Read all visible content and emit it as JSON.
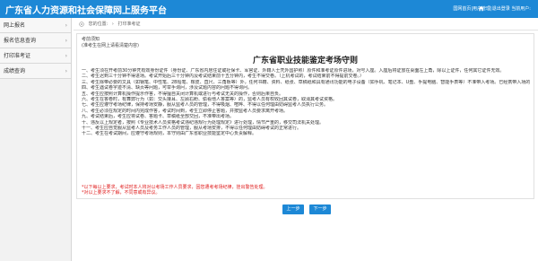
{
  "header": {
    "title": "广东省人力资源和社会保障网上服务平台",
    "user_info": "国网首页|用户管理|退出登录  当前用户:"
  },
  "sidebar": {
    "items": [
      {
        "label": "网上报名"
      },
      {
        "label": "报名信息查询"
      },
      {
        "label": "打印准考证"
      },
      {
        "label": "成绩查询"
      }
    ]
  },
  "breadcrumb": {
    "prefix": "您的位置:",
    "current": "打印准考证"
  },
  "notice": {
    "head_line1": "考前须知",
    "head_line2": "(准考生在网上请看清楚内容)",
    "title": "广东省职业技能鉴定考场守则",
    "rules": [
      "一、考生须在开考前30分钟凭有效身份证件（身份证、广东省内居住证或社保卡、军官证、外籍人士凭外国护照）原件和准考证原件进场，对号入座。入座后将证放在桌面左上角，除以上证件，任何其它证件无效。",
      "二、考生迟到三十分钟不得进场。考试开始后三十分钟内及考试结束前十五分钟内，考生不得交卷。（上机考试的，考试结束前不得提前交卷。）",
      "三、考生除带必要的文具（如钢笔、中性笔、2B铅笔、橡皮、直尺、三角板等）外，任何书籍、资料、纸张、草稿纸和具有通讯功能的电子设备（如手机、笔记本、U盘、手提电脑、智能手表等）不准带入考场。已经携带入场的应按照监考人员的要求，集中存放在指定地点，考试期间，不准取用和使用，考试期间手机应关机或设置为飞行模式。",
      "四、考生遇试卷字迹不清、缺页等问题，可举手询问，涉及试题内容的问题不得询问。",
      "五、考生应按照计算机操作提示作答，不得擅自关闭计算机或进行与考试无关的操作，否则后果自负。",
      "六、考生在答卷时，有舞弊行为（如：交头接耳、左顾右盼、偷看他人答案等）的，监考人员有权收回其试卷，取消其考试资格。",
      "七、考生应遵守考场纪律，保持考场安静，服从监考人员的管理，不得吸烟、喧哗、不得以任何理由妨碍监考人员执行公务。",
      "八、考生必须在规定的时间内完成作答，考试时间到，考生立即停止答题，并按监考人员要求离开考场。",
      "九、考试结束后，考生应将试卷、答题卡、草稿纸全部交回，不准带出考场。",
      "十、违反以上规定者，按照《专业技术人员资格考试违纪违规行为处理规定》进行处理，情节严重的，移交司法机关处理。",
      "十一、考生应自觉服从监考人员及考务工作人员的管理，服从考场安排，不得以任何理由妨碍考试的正常进行。",
      "十二、考生在考试期间，应遵守考场规则，本守则由广东省职业技能鉴定中心负责解释。"
    ],
    "notes": [
      "*以下每以上要求，考试时本人将对以考场工作人员要求，因您遭考考场纪律，挂出警告处理。",
      "*对以上要求不了解，不同意或有异议。"
    ]
  },
  "buttons": {
    "prev": "上一步",
    "next": "下一步"
  },
  "colors": {
    "brand": "#1d88d6",
    "warning": "#e02020"
  }
}
